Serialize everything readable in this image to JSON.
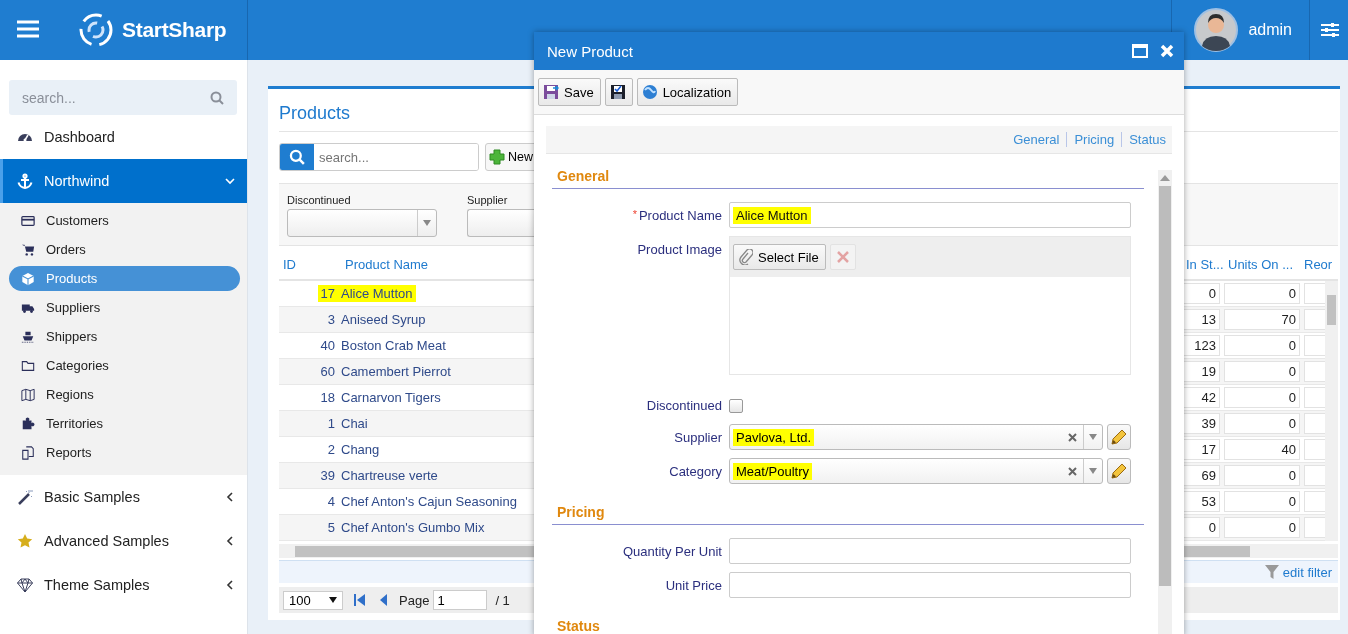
{
  "header": {
    "app_name": "StartSharp",
    "user_name": "admin"
  },
  "sidebar": {
    "search": {
      "placeholder": "search..."
    },
    "items": [
      {
        "kind": "link",
        "label": "Dashboard",
        "selected": false
      },
      {
        "kind": "group",
        "label": "Northwind",
        "selected": true,
        "expanded": true,
        "children": [
          {
            "label": "Customers",
            "selected": false
          },
          {
            "label": "Orders",
            "selected": false
          },
          {
            "label": "Products",
            "selected": true
          },
          {
            "label": "Suppliers",
            "selected": false
          },
          {
            "label": "Shippers",
            "selected": false
          },
          {
            "label": "Categories",
            "selected": false
          },
          {
            "label": "Regions",
            "selected": false
          },
          {
            "label": "Territories",
            "selected": false
          },
          {
            "label": "Reports",
            "selected": false
          }
        ]
      },
      {
        "kind": "group",
        "label": "Basic Samples",
        "selected": false,
        "expanded": false
      },
      {
        "kind": "group",
        "label": "Advanced Samples",
        "selected": false,
        "expanded": false
      },
      {
        "kind": "group",
        "label": "Theme Samples",
        "selected": false,
        "expanded": false
      }
    ]
  },
  "grid": {
    "title": "Products",
    "search": {
      "placeholder": "search..."
    },
    "new_button": "New",
    "filters": [
      {
        "label": "Discontinued",
        "covered": false
      },
      {
        "label": "Supplier",
        "covered": true
      }
    ],
    "columns": [
      "ID",
      "Product Name",
      "In St...",
      "Units On ...",
      "Reor"
    ],
    "rows": [
      {
        "id": "17",
        "name": "Alice Mutton",
        "in_stock": "0",
        "units_on_order": "0",
        "highlighted": true
      },
      {
        "id": "3",
        "name": "Aniseed Syrup",
        "in_stock": "13",
        "units_on_order": "70",
        "highlighted": false
      },
      {
        "id": "40",
        "name": "Boston Crab Meat",
        "in_stock": "123",
        "units_on_order": "0",
        "highlighted": false
      },
      {
        "id": "60",
        "name": "Camembert Pierrot",
        "in_stock": "19",
        "units_on_order": "0",
        "highlighted": false
      },
      {
        "id": "18",
        "name": "Carnarvon Tigers",
        "in_stock": "42",
        "units_on_order": "0",
        "highlighted": false
      },
      {
        "id": "1",
        "name": "Chai",
        "in_stock": "39",
        "units_on_order": "0",
        "highlighted": false
      },
      {
        "id": "2",
        "name": "Chang",
        "in_stock": "17",
        "units_on_order": "40",
        "highlighted": false
      },
      {
        "id": "39",
        "name": "Chartreuse verte",
        "in_stock": "69",
        "units_on_order": "0",
        "highlighted": false
      },
      {
        "id": "4",
        "name": "Chef Anton's Cajun Seasoning",
        "in_stock": "53",
        "units_on_order": "0",
        "highlighted": false
      },
      {
        "id": "5",
        "name": "Chef Anton's Gumbo Mix",
        "in_stock": "0",
        "units_on_order": "0",
        "highlighted": false
      }
    ],
    "edit_filter": "edit filter",
    "pager": {
      "page_size": "100",
      "page_label": "Page",
      "page": "1",
      "page_total": "/ 1"
    }
  },
  "dialog": {
    "title": "New Product",
    "toolbar": [
      {
        "kind": "save",
        "label": "Save"
      },
      {
        "kind": "apply"
      },
      {
        "kind": "localization",
        "label": "Localization"
      }
    ],
    "section_links": [
      "General",
      "Pricing",
      "Status"
    ],
    "sections": [
      {
        "title": "General",
        "fields": [
          {
            "kind": "text",
            "label": "Product Name",
            "required_mark": "*",
            "value": "Alice Mutton",
            "highlighted": true
          },
          {
            "kind": "image",
            "label": "Product Image",
            "button": "Select File"
          },
          {
            "kind": "checkbox",
            "label": "Discontinued",
            "checked": false
          },
          {
            "kind": "lookup",
            "label": "Supplier",
            "value": "Pavlova, Ltd.",
            "highlighted": true
          },
          {
            "kind": "lookup",
            "label": "Category",
            "value": "Meat/Poultry",
            "highlighted": true
          }
        ]
      },
      {
        "title": "Pricing",
        "fields": [
          {
            "kind": "text",
            "label": "Quantity Per Unit"
          },
          {
            "kind": "text",
            "label": "Unit Price"
          }
        ]
      },
      {
        "title": "Status"
      }
    ]
  }
}
